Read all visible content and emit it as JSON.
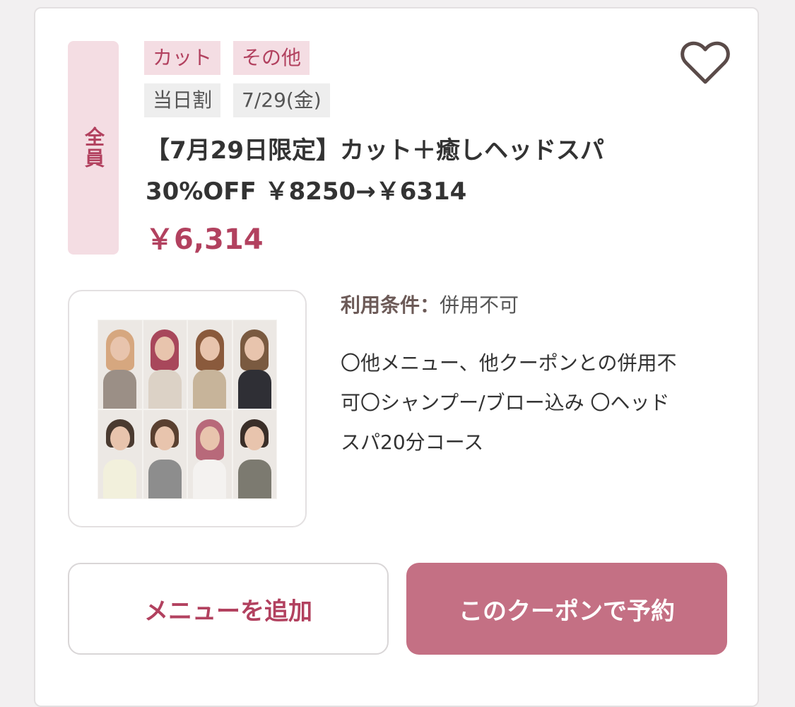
{
  "coupon": {
    "target": "全員",
    "category_tags": [
      "カット",
      "その他"
    ],
    "info_tags": [
      "当日割",
      "7/29(金)"
    ],
    "title_lines": [
      "【7月29日限定】カット＋癒しヘッドスパ",
      "30%OFF ￥8250→￥6314"
    ],
    "price": "￥6,314",
    "conditions_label": "利用条件：",
    "conditions_value": "併用不可",
    "description_lines": [
      "〇他メニュー、他クーポンとの併用不",
      "可〇シャンプー/ブロー込み 〇ヘッド",
      "スパ20分コース"
    ],
    "favorite_icon": "heart-outline-icon"
  },
  "buttons": {
    "add_menu": "メニューを追加",
    "reserve": "このクーポンで予約"
  },
  "colors": {
    "accent": "#b2415f",
    "badge_bg": "#f4dde3",
    "reserve_button": "#c47084",
    "info_tag_bg": "#eeeeee"
  }
}
